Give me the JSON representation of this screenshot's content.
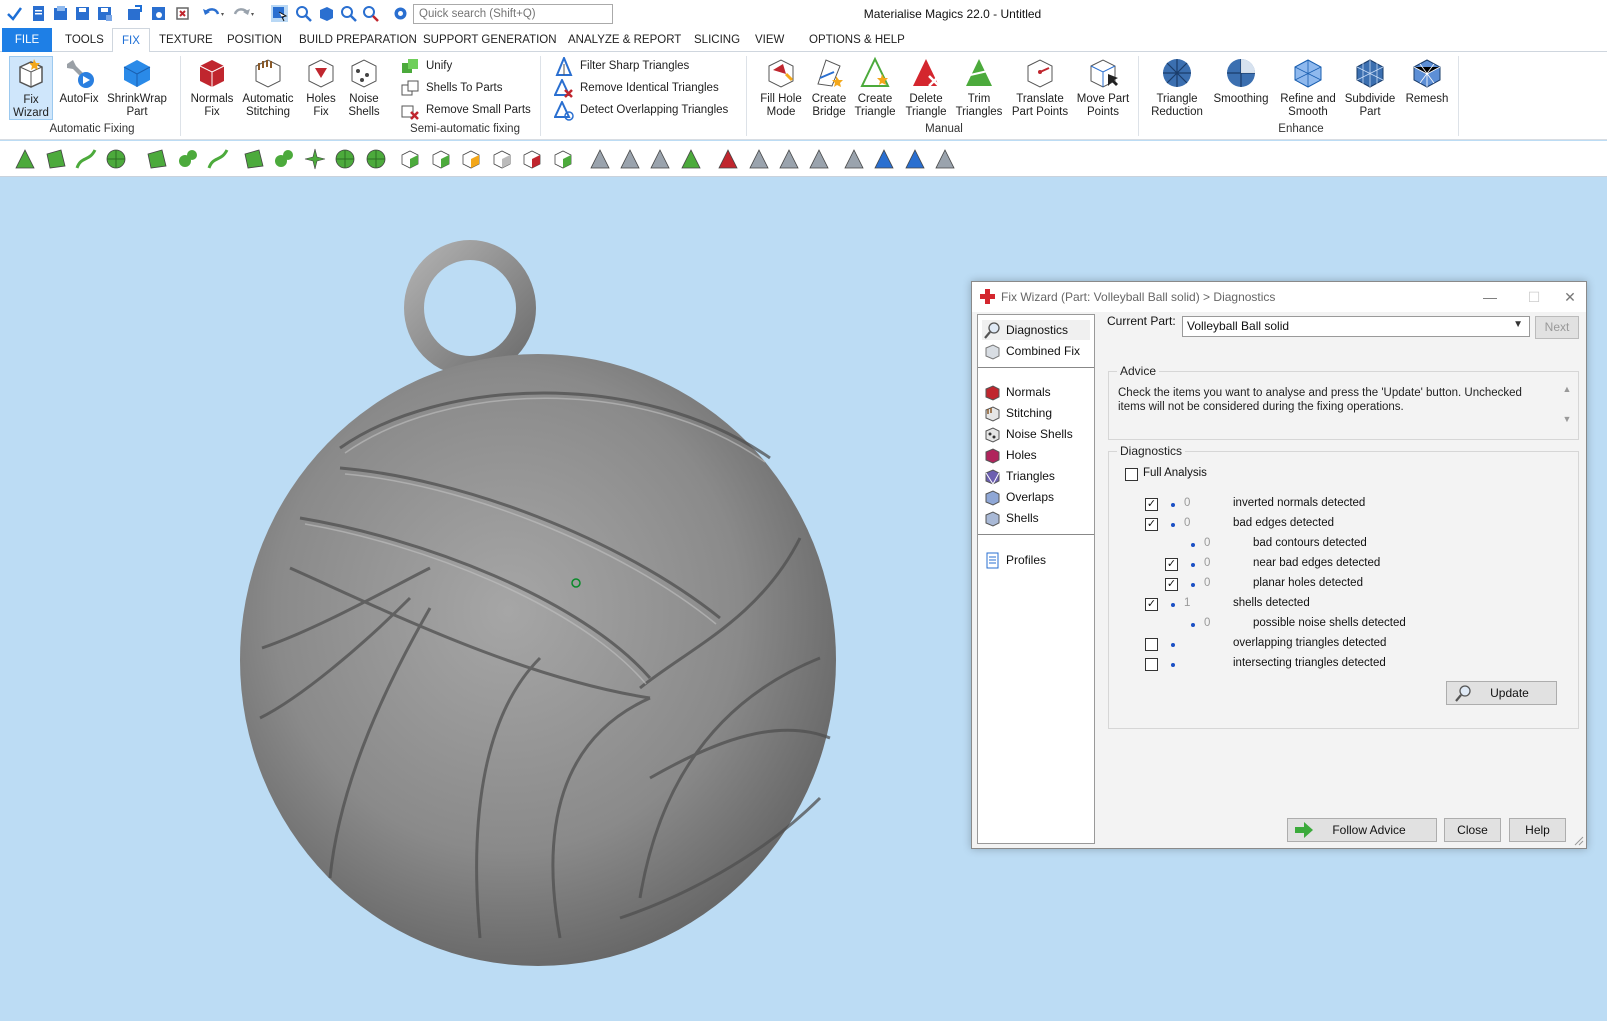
{
  "app": {
    "title": "Materialise Magics 22.0 - Untitled",
    "quick_search_placeholder": "Quick search (Shift+Q)"
  },
  "menu": {
    "tabs": [
      "FILE",
      "TOOLS",
      "FIX",
      "TEXTURE",
      "POSITION",
      "BUILD PREPARATION",
      "SUPPORT GENERATION",
      "ANALYZE & REPORT",
      "SLICING",
      "VIEW",
      "OPTIONS & HELP"
    ],
    "active": "FIX"
  },
  "ribbon": {
    "fix_wizard": [
      "Fix",
      "Wizard"
    ],
    "autofix": [
      "AutoFix",
      ""
    ],
    "shrinkwrap": [
      "ShrinkWrap",
      "Part"
    ],
    "group_automatic": "Automatic Fixing",
    "normals_fix": [
      "Normals",
      "Fix"
    ],
    "auto_stitching": [
      "Automatic",
      "Stitching"
    ],
    "holes_fix": [
      "Holes",
      "Fix"
    ],
    "noise_shells": [
      "Noise",
      "Shells"
    ],
    "unify": "Unify",
    "shells_to_parts": "Shells To Parts",
    "remove_small_parts": "Remove Small Parts",
    "group_semi": "Semi-automatic fixing",
    "filter_sharp": "Filter Sharp Triangles",
    "remove_identical": "Remove Identical Triangles",
    "detect_overlapping": "Detect Overlapping Triangles",
    "fill_hole_mode": [
      "Fill Hole",
      "Mode"
    ],
    "create_bridge": [
      "Create",
      "Bridge"
    ],
    "create_triangle": [
      "Create",
      "Triangle"
    ],
    "delete_triangle": [
      "Delete",
      "Triangle"
    ],
    "trim_triangles": [
      "Trim",
      "Triangles"
    ],
    "translate_points": [
      "Translate",
      "Part Points"
    ],
    "move_points": [
      "Move Part",
      "Points"
    ],
    "group_manual": "Manual",
    "triangle_reduction": [
      "Triangle",
      "Reduction"
    ],
    "smoothing": [
      "Smoothing",
      ""
    ],
    "refine_smooth": [
      "Refine and",
      "Smooth"
    ],
    "subdivide": [
      "Subdivide",
      "Part"
    ],
    "remesh": [
      "Remesh",
      ""
    ],
    "group_enhance": "Enhance"
  },
  "dialog": {
    "title": "Fix Wizard (Part: Volleyball Ball solid) > Diagnostics",
    "nav": [
      "Diagnostics",
      "Combined Fix",
      "Normals",
      "Stitching",
      "Noise Shells",
      "Holes",
      "Triangles",
      "Overlaps",
      "Shells",
      "Profiles"
    ],
    "current_part_label": "Current Part:",
    "current_part_value": "Volleyball Ball solid",
    "next_label": "Next",
    "advice_title": "Advice",
    "advice_text": "Check the items you want to analyse and press the 'Update' button. Unchecked items will not be considered during the fixing operations.",
    "diagnostics_title": "Diagnostics",
    "full_analysis_label": "Full Analysis",
    "full_analysis_checked": false,
    "rows": [
      {
        "label": "inverted normals detected",
        "count": "0",
        "checked": true
      },
      {
        "label": "bad edges detected",
        "count": "0",
        "checked": true
      },
      {
        "label": "bad contours detected",
        "count": "0"
      },
      {
        "label": "near bad edges detected",
        "count": "0",
        "checked": true
      },
      {
        "label": "planar holes detected",
        "count": "0",
        "checked": true
      },
      {
        "label": "shells detected",
        "count": "1",
        "checked": true
      },
      {
        "label": "possible noise shells detected",
        "count": "0"
      },
      {
        "label": "overlapping triangles detected",
        "count": "",
        "checked": false
      },
      {
        "label": "intersecting triangles detected",
        "count": "",
        "checked": false
      }
    ],
    "update_label": "Update",
    "follow_advice_label": "Follow Advice",
    "close_label": "Close",
    "help_label": "Help"
  },
  "colors": {
    "viewport_bg": "#bcdcf4",
    "accent": "#1e7fe6",
    "model": "#8c8c8c"
  }
}
